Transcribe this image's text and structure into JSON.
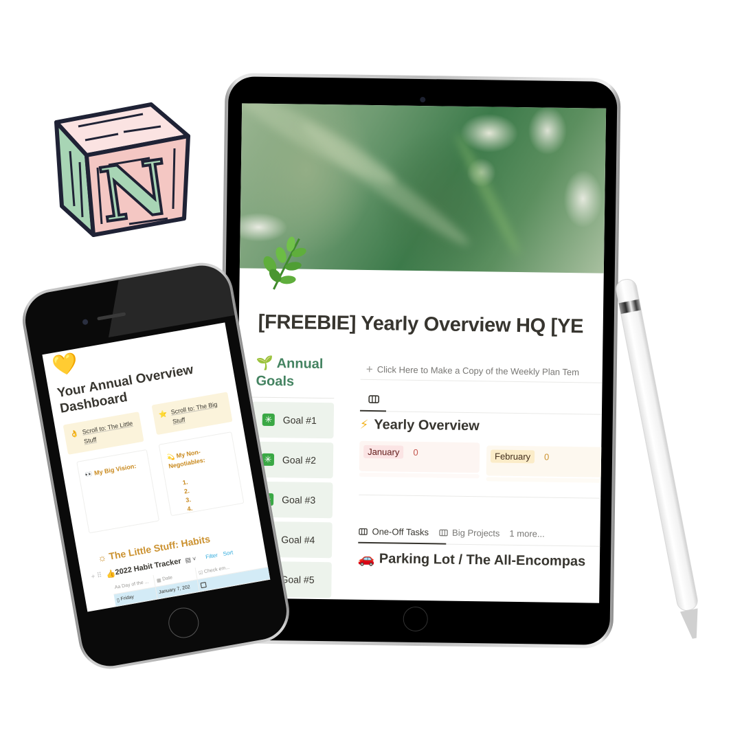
{
  "logo": {
    "letter": "N",
    "name": "Notion"
  },
  "ipad": {
    "page_icon": "herb-icon",
    "page_title": "[FREEBIE] Yearly Overview HQ [YE",
    "goals": {
      "heading_icon": "🌱",
      "heading": "Annual Goals",
      "items": [
        {
          "icon": "✳",
          "label": "Goal #1"
        },
        {
          "icon": "✳",
          "label": "Goal #2"
        },
        {
          "icon": "✳",
          "label": "Goal #3"
        },
        {
          "icon": "✳",
          "label": "Goal #4"
        },
        {
          "icon": "✳",
          "label": "Goal #5"
        }
      ]
    },
    "copy_link": "Click Here to Make a Copy of the Weekly Plan Tem",
    "yearly_overview": {
      "icon": "⚡",
      "heading": "Yearly Overview",
      "months": [
        {
          "name": "January",
          "count": "0",
          "color": "#fbe4e4"
        },
        {
          "name": "February",
          "count": "0",
          "color": "#fbecc8"
        }
      ]
    },
    "tabs": [
      {
        "label": "One-Off Tasks",
        "active": true
      },
      {
        "label": "Big Projects",
        "active": false
      }
    ],
    "more_tabs": "1 more...",
    "parking_lot": {
      "icon": "🚗",
      "heading": "Parking Lot / The All-Encompas"
    }
  },
  "iphone": {
    "page_icon": "💛",
    "page_title": "Your Annual Overview Dashboard",
    "callouts": [
      {
        "icon": "👌",
        "label": "Scroll to: The Little Stuff"
      },
      {
        "icon": "⭐",
        "label": "Scroll to: The Big Stuff"
      }
    ],
    "big_vision": {
      "icon": "👀",
      "label": "My Big Vision:"
    },
    "non_negotiables": {
      "icon": "💫",
      "label": "My Non-Negotiables:",
      "items": [
        "1.",
        "2.",
        "3.",
        "4."
      ]
    },
    "habits_heading": {
      "icon": "☼",
      "label": "The Little Stuff: Habits"
    },
    "tracker": {
      "icon": "👍",
      "title": "2022 Habit Tracker",
      "filter": "Filter",
      "sort": "Sort",
      "columns": [
        "Day of the ...",
        "Date",
        "Check em..."
      ],
      "rows": [
        {
          "day": "Friday",
          "date": "January 7, 202",
          "checked": false
        }
      ]
    }
  },
  "accent_colors": {
    "goals_green": "#448361",
    "habits_orange": "#cb912f",
    "link_blue": "#2eaadc"
  }
}
